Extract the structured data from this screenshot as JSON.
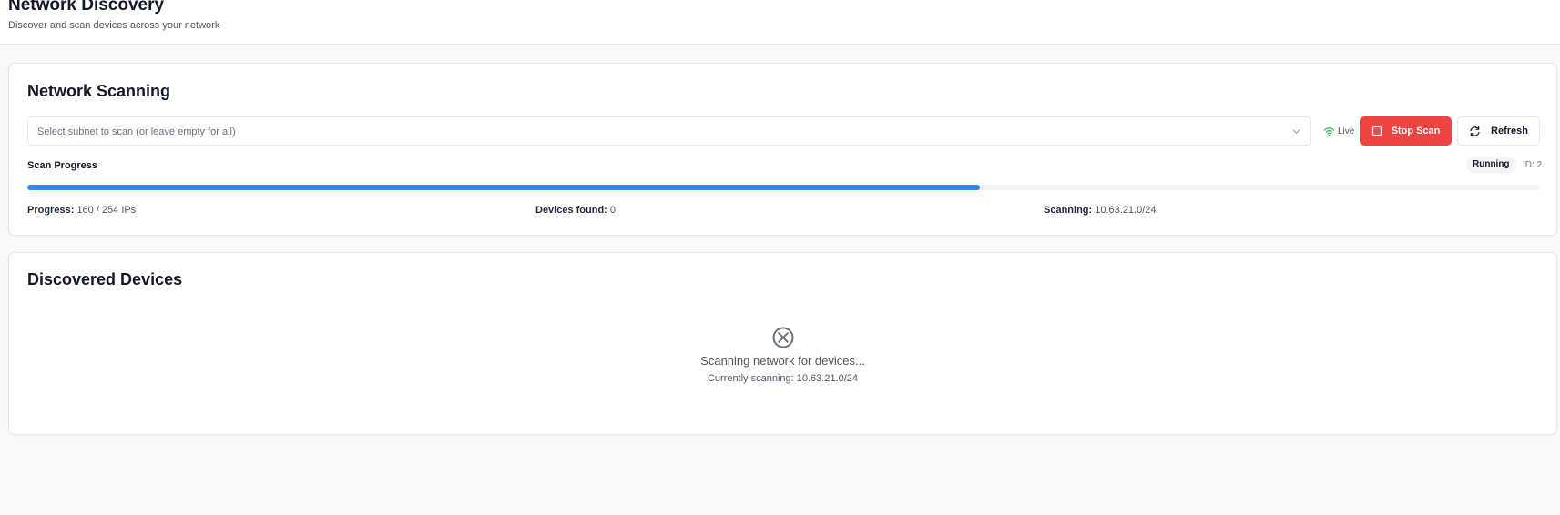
{
  "header": {
    "title": "Network Discovery",
    "subtitle": "Discover and scan devices across your network"
  },
  "scan_card": {
    "title": "Network Scanning",
    "subnet_select": {
      "placeholder": "Select subnet to scan (or leave empty for all)",
      "icon": "chevron-down-icon"
    },
    "live": {
      "label": "Live",
      "icon": "wifi-icon",
      "color": "#22c55e"
    },
    "stop_button": {
      "label": "Stop Scan",
      "icon": "stop-square-icon",
      "color": "#ef4444"
    },
    "refresh_button": {
      "label": "Refresh",
      "icon": "refresh-icon"
    },
    "progress": {
      "label": "Scan Progress",
      "status": "Running",
      "id_text": "ID: 2",
      "scanned": 160,
      "total": 254,
      "bar_color": "#2b8be6"
    },
    "stats": {
      "progress_key": "Progress:",
      "progress_value": "160 / 254 IPs",
      "devices_key": "Devices found:",
      "devices_value": "0",
      "scanning_key": "Scanning:",
      "scanning_value": "10.63.21.0/24"
    }
  },
  "devices_card": {
    "title": "Discovered Devices",
    "empty_state": {
      "icon": "scan-x-circle-icon",
      "title": "Scanning network for devices...",
      "subtitle": "Currently scanning: 10.63.21.0/24"
    }
  }
}
